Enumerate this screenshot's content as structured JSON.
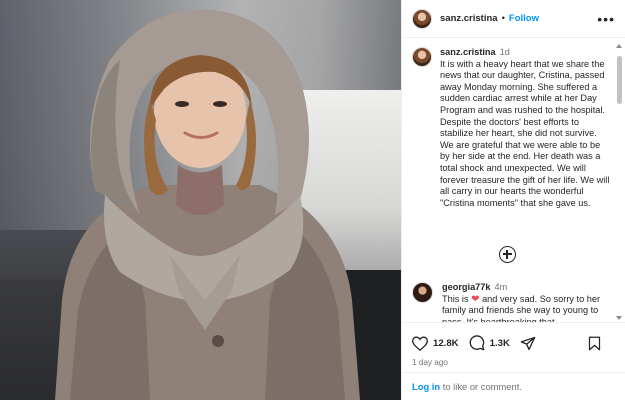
{
  "photo": {
    "alt_subject": "woman-in-fur-hood-coat"
  },
  "header": {
    "username": "sanz.cristina",
    "separator": "•",
    "follow_label": "Follow",
    "more_icon": "more-horizontal-icon"
  },
  "caption": {
    "username": "sanz.cristina",
    "time": "1d",
    "text": "It is with a heavy heart that we share the news that our daughter, Cristina, passed away Monday morning. She suffered a sudden cardiac arrest while at her Day Program and was rushed to the hospital. Despite the doctors' best efforts to stabilize her heart, she did not survive. We are grateful that we were able to be by her side at the end. Her death was a total shock and unexpected. We will forever treasure the gift of her life. We will all carry in our hearts the wonderful \"Cristina moments\" that she gave us."
  },
  "load_more_icon": "plus-circle-icon",
  "comment": {
    "username": "georgia77k",
    "time": "4m",
    "text_before": "This is",
    "text_after": "and very sad. So sorry to her family and friends she way to young to pass. It's heartbreaking that"
  },
  "actions": {
    "likes": "12.8K",
    "comments": "1.3K",
    "ago": "1 day ago"
  },
  "login": {
    "link": "Log in",
    "rest": "to like or comment."
  },
  "colors": {
    "accent": "#0095f6",
    "heart": "#ed4956",
    "text": "#262626",
    "muted": "#737373"
  }
}
